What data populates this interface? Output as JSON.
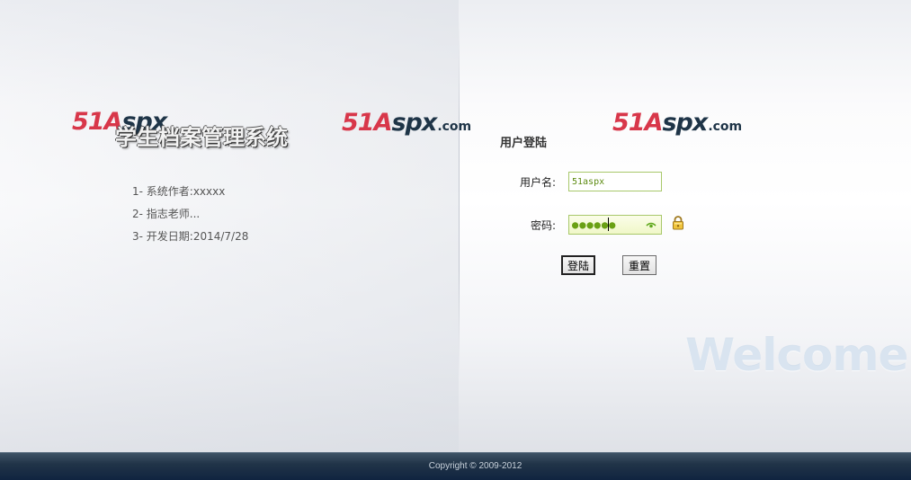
{
  "branding": {
    "logo_main": "51Aspx",
    "logo_suffix": ".com",
    "logo_red": "#d8374a",
    "logo_dark": "#1e3447"
  },
  "intro": {
    "system_title": "学生档案管理系统",
    "items": [
      "1- 系统作者:xxxxx",
      "2- 指志老师...",
      "3- 开发日期:2014/7/28"
    ]
  },
  "login": {
    "title": "用户登陆",
    "username_label": "用户名:",
    "username_value": "51aspx",
    "password_label": "密码:",
    "password_masked": "●●●●●●",
    "login_button": "登陆",
    "reset_button": "重置"
  },
  "decor": {
    "welcome_text": "Welcome"
  },
  "footer": {
    "copyright": "Copyright © 2009-2012"
  },
  "icons": {
    "password_toggle": "eye-icon",
    "password_lock": "lock-icon"
  }
}
